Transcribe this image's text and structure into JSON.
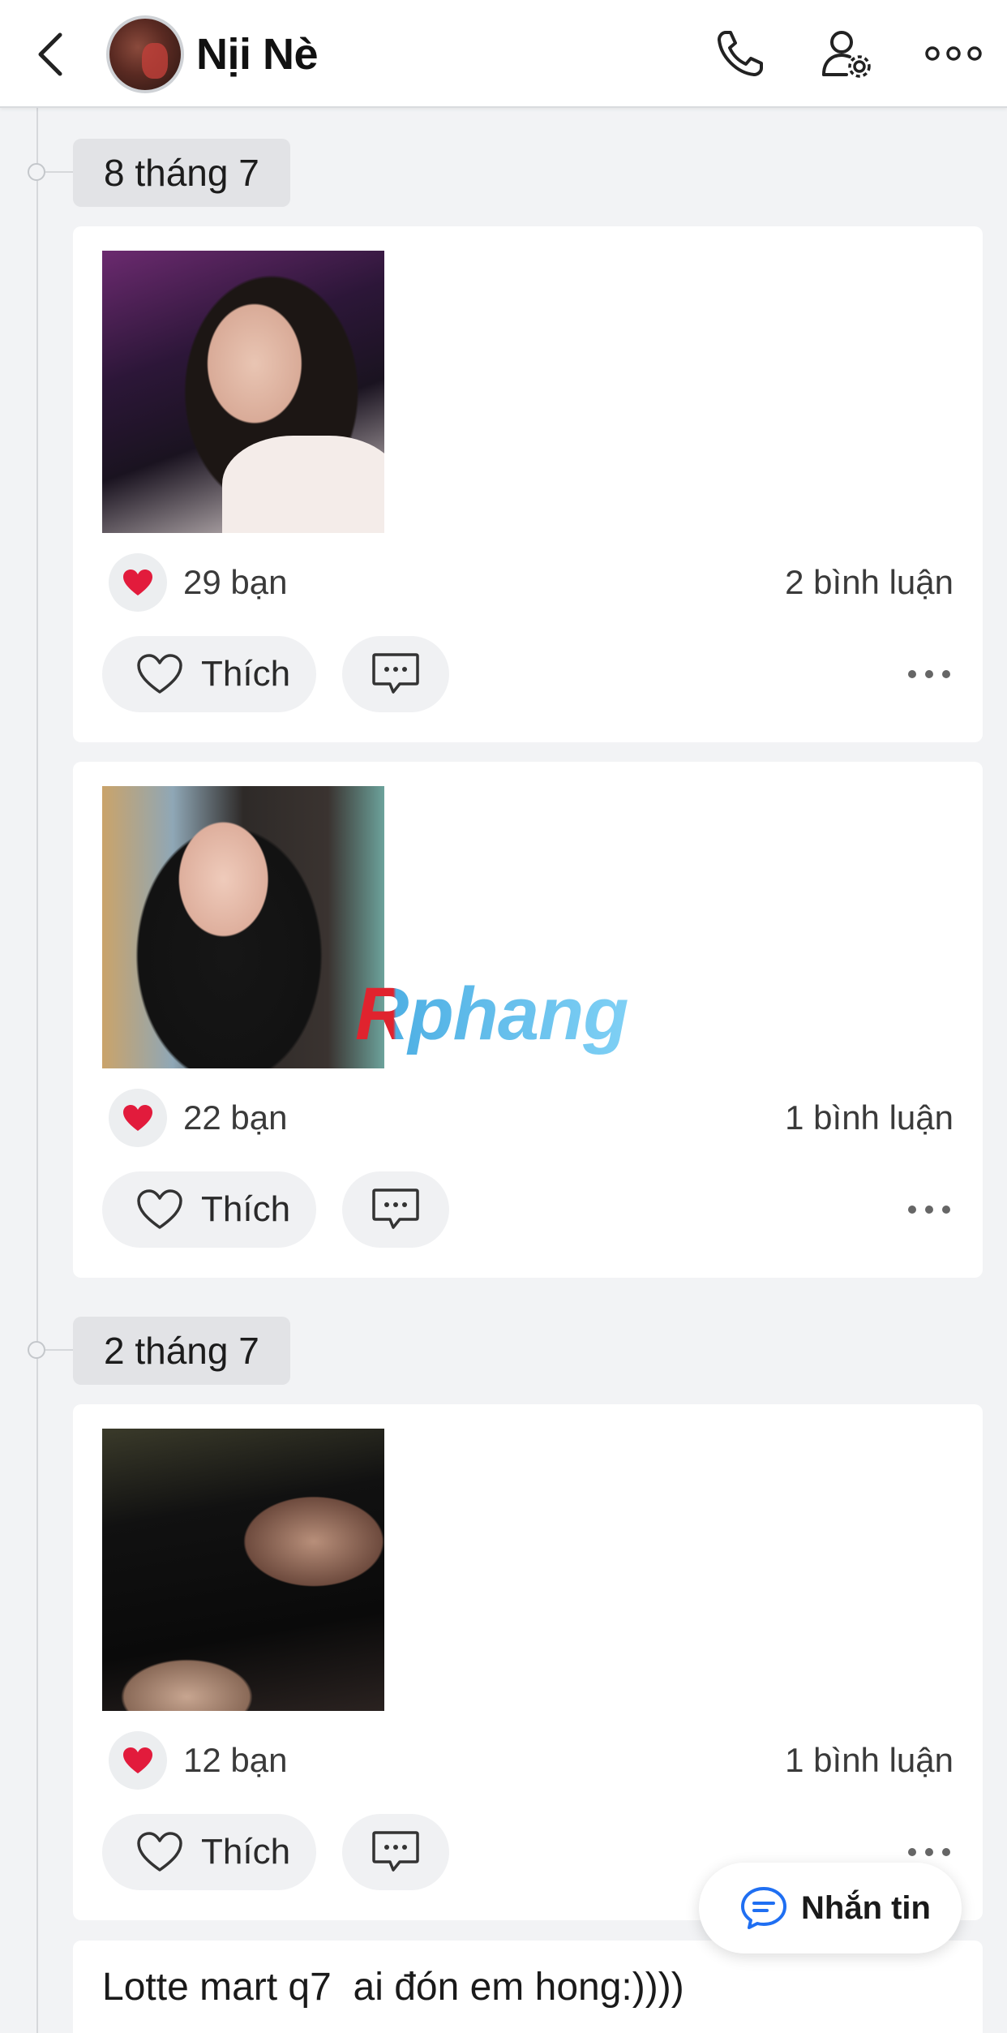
{
  "header": {
    "profile_name": "Nịi Nè"
  },
  "timeline": {
    "groups": [
      {
        "date": "8 tháng 7"
      },
      {
        "date": "2 tháng 7"
      }
    ],
    "posts": [
      {
        "likes": "29 bạn",
        "comments": "2 bình luận",
        "like_label": "Thích"
      },
      {
        "likes": "22 bạn",
        "comments": "1 bình luận",
        "like_label": "Thích"
      },
      {
        "likes": "12 bạn",
        "comments": "1 bình luận",
        "like_label": "Thích"
      }
    ],
    "text_post": {
      "text": "Lotte mart q7  ai đón em hong:))))"
    }
  },
  "watermark": "Rphang",
  "message_button": {
    "label": "Nhắn tin"
  },
  "colors": {
    "accent_blue": "#1f6ff2",
    "heart_red": "#e21b3c",
    "background": "#f2f3f5"
  },
  "icons": [
    "back-arrow-icon",
    "phone-icon",
    "user-settings-icon",
    "more-horizontal-icon",
    "heart-icon",
    "comment-icon",
    "chat-bubble-icon"
  ]
}
